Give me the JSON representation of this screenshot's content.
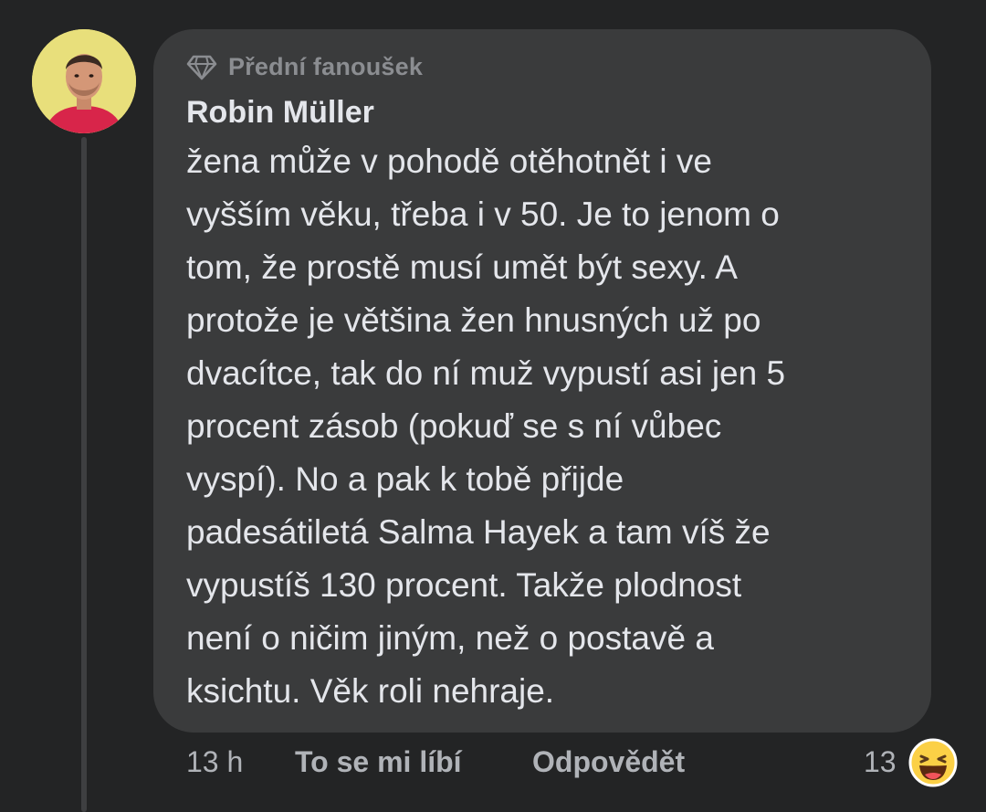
{
  "comment": {
    "badge_label": "Přední fanoušek",
    "badge_icon": "diamond-icon",
    "author": "Robin Müller",
    "text_lines": [
      "žena může v pohodě otěhotnět i ve",
      "vyšším věku, třeba i v 50. Je to jenom o",
      "tom, že prostě musí umět být sexy. A",
      "protože je většina žen hnusných už po",
      "dvacítce, tak do ní muž vypustí asi jen 5",
      "procent zásob (pokuď se s ní vůbec",
      "vyspí). No a pak k tobě přijde",
      "padesátiletá Salma Hayek a tam víš že",
      "vypustíš 130 procent. Takže plodnost",
      "není o ničim jiným, než o postavě a",
      "ksichtu. Věk roli nehraje."
    ]
  },
  "actions": {
    "time": "13 h",
    "like_label": "To se mi líbí",
    "reply_label": "Odpovědět",
    "reaction_count": "13",
    "reaction_icon": "haha-emoji-icon"
  },
  "colors": {
    "background": "#232425",
    "bubble": "#3a3b3c",
    "text": "#e4e6eb",
    "muted": "#b0b3b8"
  }
}
